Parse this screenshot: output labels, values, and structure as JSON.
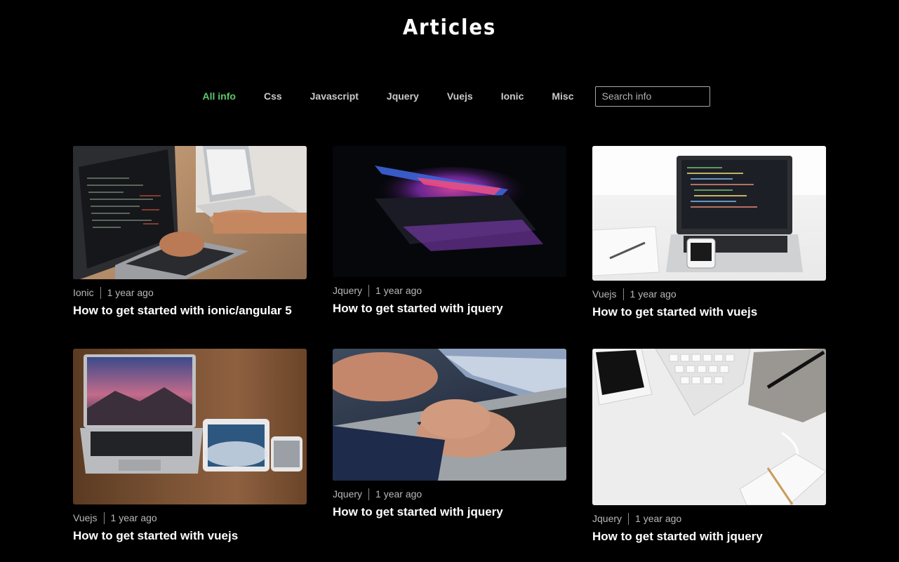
{
  "header": {
    "title": "Articles"
  },
  "filters": {
    "items": [
      {
        "label": "All info",
        "active": true
      },
      {
        "label": "Css",
        "active": false
      },
      {
        "label": "Javascript",
        "active": false
      },
      {
        "label": "Jquery",
        "active": false
      },
      {
        "label": "Vuejs",
        "active": false
      },
      {
        "label": "Ionic",
        "active": false
      },
      {
        "label": "Misc",
        "active": false
      }
    ],
    "search_placeholder": "Search info"
  },
  "articles": [
    {
      "category": "Ionic",
      "time": "1 year ago",
      "title": "How to get started with ionic/angular 5"
    },
    {
      "category": "Jquery",
      "time": "1 year ago",
      "title": "How to get started with jquery"
    },
    {
      "category": "Vuejs",
      "time": "1 year ago",
      "title": "How to get started with vuejs"
    },
    {
      "category": "Vuejs",
      "time": "1 year ago",
      "title": "How to get started with vuejs"
    },
    {
      "category": "Jquery",
      "time": "1 year ago",
      "title": "How to get started with jquery"
    },
    {
      "category": "Jquery",
      "time": "1 year ago",
      "title": "How to get started with jquery"
    }
  ],
  "colors": {
    "active_filter": "#5bc86a",
    "background": "#000000"
  }
}
